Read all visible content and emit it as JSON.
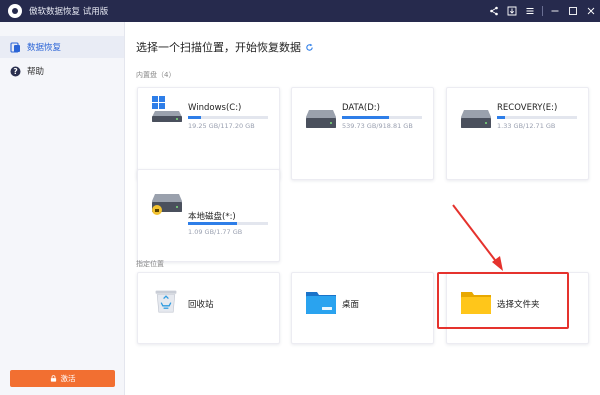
{
  "titlebar": {
    "title": "傲软数据恢复 试用版"
  },
  "sidebar": {
    "items": [
      {
        "label": "数据恢复",
        "icon": "data-recovery-icon"
      },
      {
        "label": "帮助",
        "icon": "help-icon"
      }
    ],
    "activate_label": "激活"
  },
  "main": {
    "title": "选择一个扫描位置，开始恢复数据",
    "builtin_label": "内置盘（4）",
    "drives": [
      {
        "name": "Windows(C:)",
        "size": "19.25 GB/117.20 GB",
        "used": 0.164,
        "icon": "windows-drive-icon"
      },
      {
        "name": "DATA(D:)",
        "size": "539.73 GB/918.81 GB",
        "used": 0.587,
        "icon": "hard-drive-icon"
      },
      {
        "name": "RECOVERY(E:)",
        "size": "1.33 GB/12.71 GB",
        "used": 0.105,
        "icon": "hard-drive-icon"
      },
      {
        "name": "本地磁盘(*:)",
        "size": "1.09 GB/1.77 GB",
        "used": 0.616,
        "icon": "hard-drive-locked-icon"
      }
    ],
    "location_label": "指定位置",
    "locations": [
      {
        "name": "回收站",
        "icon": "recycle-bin-icon"
      },
      {
        "name": "桌面",
        "icon": "desktop-folder-icon"
      },
      {
        "name": "选择文件夹",
        "icon": "folder-icon"
      }
    ]
  },
  "colors": {
    "titlebar": "#262a4d",
    "accent": "#2e7ee8",
    "activate": "#f26f31",
    "annotation": "#e5322d"
  }
}
